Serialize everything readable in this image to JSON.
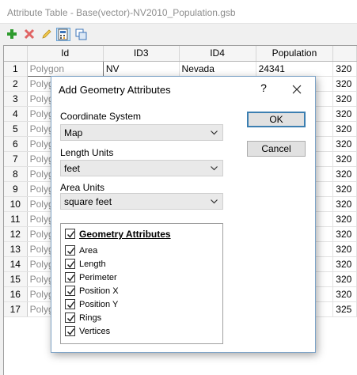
{
  "window": {
    "title": "Attribute Table - Base(vector)-NV2010_Population.gsb"
  },
  "toolbar": {
    "icons": [
      "add-row-icon",
      "delete-row-icon",
      "edit-pencil-icon",
      "calculator-icon",
      "copy-columns-icon"
    ]
  },
  "table": {
    "columns": [
      "Id",
      "ID3",
      "ID4",
      "Population"
    ],
    "rows": [
      {
        "num": "1",
        "id": "Polygon",
        "id3": "NV",
        "id4": "Nevada",
        "population": "24341",
        "extra": "320"
      },
      {
        "num": "2",
        "id": "Polyg",
        "extra": "320"
      },
      {
        "num": "3",
        "id": "Polyg",
        "extra": "320"
      },
      {
        "num": "4",
        "id": "Polyg",
        "extra": "320"
      },
      {
        "num": "5",
        "id": "Polyg",
        "extra": "320"
      },
      {
        "num": "6",
        "id": "Polyg",
        "extra": "320"
      },
      {
        "num": "7",
        "id": "Polyg",
        "extra": "320"
      },
      {
        "num": "8",
        "id": "Polyg",
        "extra": "320"
      },
      {
        "num": "9",
        "id": "Polyg",
        "extra": "320"
      },
      {
        "num": "10",
        "id": "Polyg",
        "extra": "320"
      },
      {
        "num": "11",
        "id": "Polyg",
        "extra": "320"
      },
      {
        "num": "12",
        "id": "Polyg",
        "extra": "320"
      },
      {
        "num": "13",
        "id": "Polyg",
        "extra": "320"
      },
      {
        "num": "14",
        "id": "Polyg",
        "extra": "320"
      },
      {
        "num": "15",
        "id": "Polyg",
        "extra": "320"
      },
      {
        "num": "16",
        "id": "Polyg",
        "extra": "320"
      },
      {
        "num": "17",
        "id": "Polyg",
        "extra": "325"
      }
    ]
  },
  "dialog": {
    "title": "Add Geometry Attributes",
    "help": "?",
    "coordinate_system": {
      "label": "Coordinate System",
      "value": "Map"
    },
    "length_units": {
      "label": "Length Units",
      "value": "feet"
    },
    "area_units": {
      "label": "Area Units",
      "value": "square feet"
    },
    "ok_label": "OK",
    "cancel_label": "Cancel",
    "attributes_header": "Geometry Attributes",
    "attributes": [
      "Area",
      "Length",
      "Perimeter",
      "Position X",
      "Position Y",
      "Rings",
      "Vertices"
    ]
  }
}
